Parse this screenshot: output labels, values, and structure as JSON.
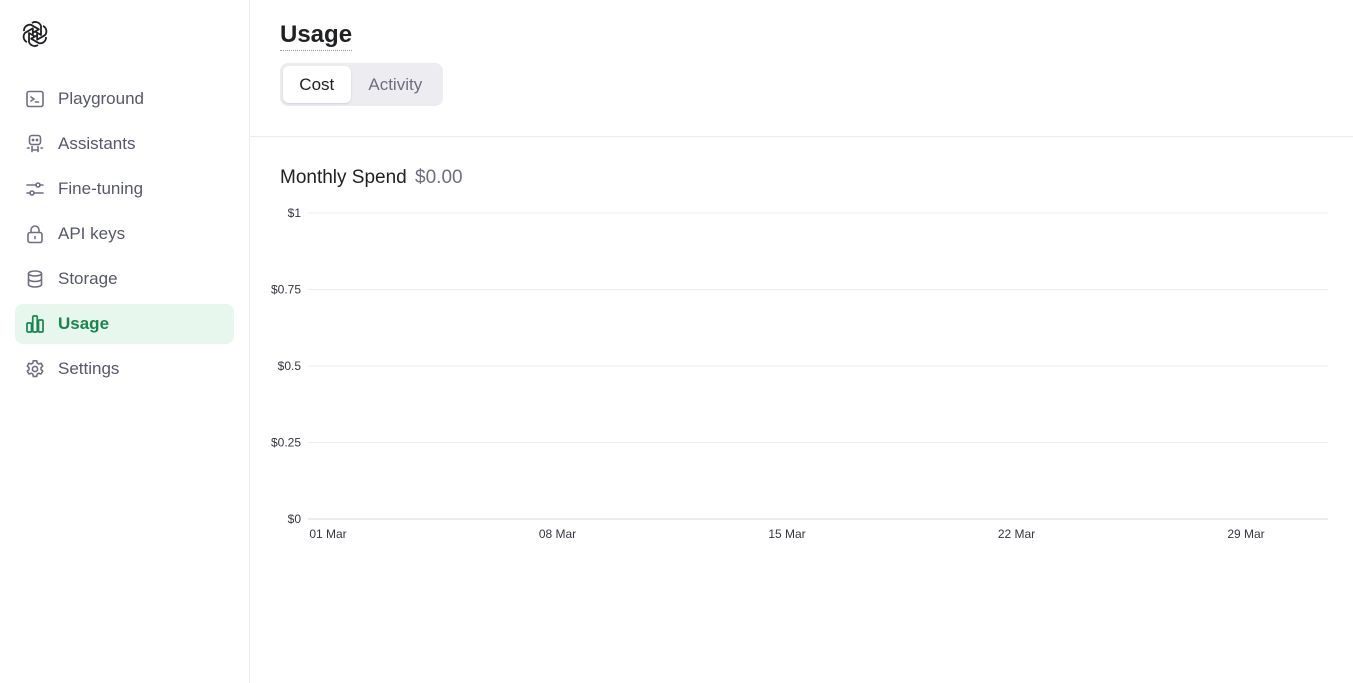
{
  "app": {
    "logo_icon": "openai-logo-icon"
  },
  "sidebar": {
    "items": [
      {
        "label": "Playground",
        "icon": "terminal-icon",
        "active": false
      },
      {
        "label": "Assistants",
        "icon": "robot-icon",
        "active": false
      },
      {
        "label": "Fine-tuning",
        "icon": "sliders-icon",
        "active": false
      },
      {
        "label": "API keys",
        "icon": "lock-icon",
        "active": false
      },
      {
        "label": "Storage",
        "icon": "database-icon",
        "active": false
      },
      {
        "label": "Usage",
        "icon": "bar-chart-icon",
        "active": true
      },
      {
        "label": "Settings",
        "icon": "gear-icon",
        "active": false
      }
    ]
  },
  "main": {
    "title": "Usage",
    "tabs": [
      {
        "label": "Cost",
        "selected": true
      },
      {
        "label": "Activity",
        "selected": false
      }
    ],
    "spend_label": "Monthly Spend",
    "spend_value": "$0.00"
  },
  "colors": {
    "accent": "#19854f",
    "accent_bg": "#e8f7ee",
    "text": "#202123",
    "muted": "#6e6e80",
    "gridline": "#ececf1"
  },
  "chart_data": {
    "type": "bar",
    "title": "",
    "xlabel": "",
    "ylabel": "",
    "y_ticks": [
      "$0",
      "$0.25",
      "$0.5",
      "$0.75",
      "$1"
    ],
    "y_tick_values": [
      0,
      0.25,
      0.5,
      0.75,
      1
    ],
    "ylim": [
      0,
      1
    ],
    "x_ticks": [
      "01 Mar",
      "08 Mar",
      "15 Mar",
      "22 Mar",
      "29 Mar"
    ],
    "x_range": [
      "01 Mar",
      "31 Mar"
    ],
    "grid": true,
    "series": [
      {
        "values": []
      }
    ]
  }
}
